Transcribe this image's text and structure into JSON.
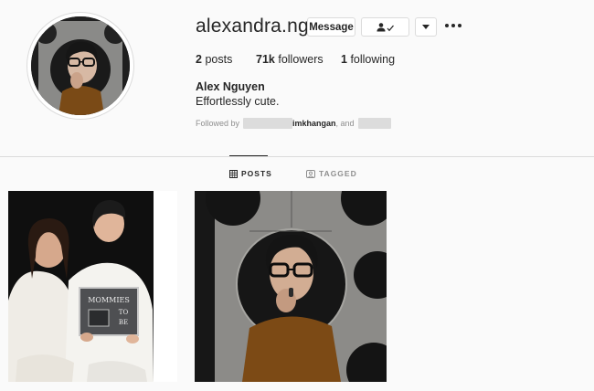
{
  "profile": {
    "username": "alexandra.ng",
    "full_name": "Alex Nguyen",
    "bio": "Effortlessly cute.",
    "followed_by_prefix": "Followed by",
    "followed_by_name": "imkhangan",
    "followed_by_mid": ", and"
  },
  "actions": {
    "message_label": "Message",
    "following_icon": "person-check-icon",
    "dropdown_icon": "caret-down-icon",
    "more_icon": "ellipsis-icon"
  },
  "stats": {
    "posts_count": "2",
    "posts_label": "posts",
    "followers_count": "71k",
    "followers_label": "followers",
    "following_count": "1",
    "following_label": "following"
  },
  "tabs": [
    {
      "label": "POSTS",
      "icon": "grid-icon",
      "active": true
    },
    {
      "label": "TAGGED",
      "icon": "tag-icon",
      "active": false
    }
  ],
  "posts": [
    {
      "sign_line1": "MOMMIES",
      "sign_line2": "TO",
      "sign_line3": "BE"
    },
    {}
  ],
  "colors": {
    "text": "#262626",
    "muted": "#8e8e8e",
    "border": "#dbdbdb",
    "background": "#fafafa"
  }
}
